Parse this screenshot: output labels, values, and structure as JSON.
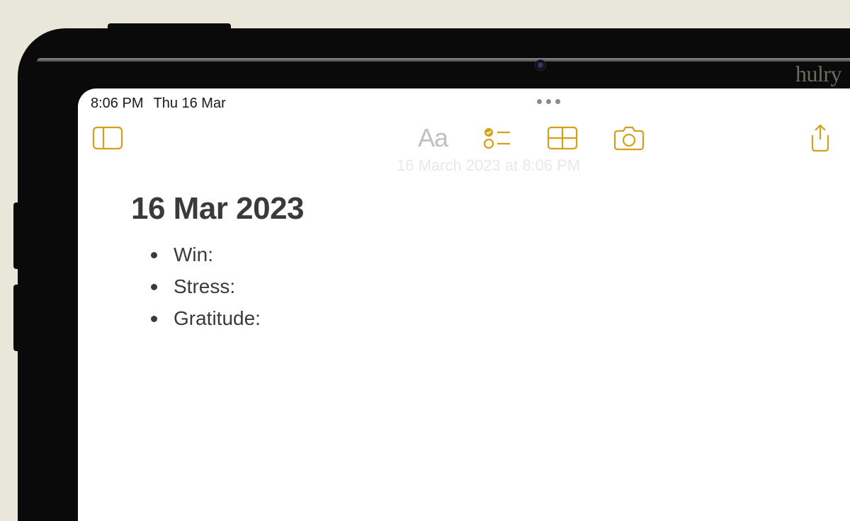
{
  "watermark": "hulry",
  "status_bar": {
    "time": "8:06 PM",
    "date": "Thu 16 Mar"
  },
  "toolbar": {
    "sidebar_icon": "sidebar",
    "text_format_icon": "Aa",
    "checklist_icon": "checklist",
    "table_icon": "table",
    "camera_icon": "camera",
    "share_icon": "share"
  },
  "note": {
    "timestamp": "16 March 2023 at 8:06 PM",
    "title": "16 Mar 2023",
    "bullets": [
      "Win:",
      "Stress:",
      "Gratitude:"
    ]
  }
}
